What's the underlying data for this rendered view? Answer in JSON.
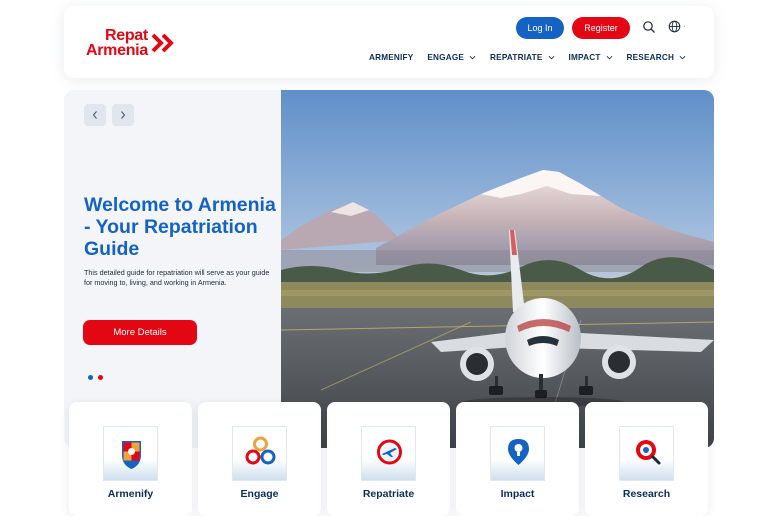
{
  "header": {
    "logo": {
      "line1": "Repat",
      "line2": "Armenia"
    },
    "login_label": "Log In",
    "register_label": "Register",
    "language_indicator": "·",
    "nav": [
      {
        "label": "ARMENIFY",
        "has_dropdown": false
      },
      {
        "label": "ENGAGE",
        "has_dropdown": true
      },
      {
        "label": "REPATRIATE",
        "has_dropdown": true
      },
      {
        "label": "IMPACT",
        "has_dropdown": true
      },
      {
        "label": "RESEARCH",
        "has_dropdown": true
      }
    ]
  },
  "hero": {
    "title": "Welcome to Armenia - Your Repatriation Guide",
    "description": "This detailed guide for repatriation will serve as your guide for moving to, living, and working in Armenia.",
    "button_label": "More Details",
    "dots": [
      {
        "color": "#1463c4"
      },
      {
        "color": "#e30613"
      }
    ]
  },
  "cards": [
    {
      "label": "Armenify",
      "icon": "shield-crest-icon"
    },
    {
      "label": "Engage",
      "icon": "rings-icon"
    },
    {
      "label": "Repatriate",
      "icon": "plane-badge-icon"
    },
    {
      "label": "Impact",
      "icon": "lightbulb-pin-icon"
    },
    {
      "label": "Research",
      "icon": "magnifier-icon"
    }
  ],
  "colors": {
    "brand_red": "#e30613",
    "brand_blue": "#1463c4",
    "navy": "#0c2d57"
  }
}
